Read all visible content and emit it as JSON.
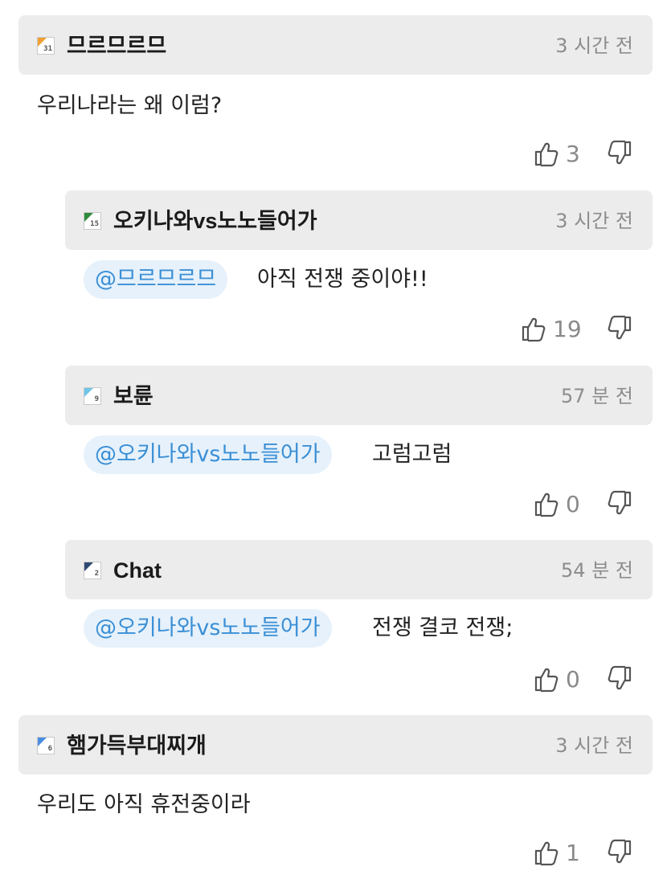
{
  "comments": [
    {
      "level": "31",
      "level_color": "#f0a033",
      "username": "므르므르므",
      "time": "3 시간 전",
      "text": "우리나라는 왜 이럼?",
      "likes": "3"
    },
    {
      "level": "15",
      "level_color": "#2f8a3c",
      "username": "오키나와vs노노들어가",
      "time": "3 시간 전",
      "mention": "@므르므르므",
      "text": "아직 전쟁 중이야!!",
      "likes": "19"
    },
    {
      "level": "9",
      "level_color": "#6ec6e8",
      "username": "보륜",
      "time": "57 분 전",
      "mention": "@오키나와vs노노들어가",
      "text": "고럼고럼",
      "likes": "0"
    },
    {
      "level": "2",
      "level_color": "#2e4a73",
      "username": "Chat",
      "time": "54 분 전",
      "mention": "@오키나와vs노노들어가",
      "text": "전쟁 결코 전쟁;",
      "likes": "0"
    },
    {
      "level": "6",
      "level_color": "#4a8ee0",
      "username": "햄가득부대찌개",
      "time": "3 시간 전",
      "text": "우리도 아직 휴전중이라",
      "likes": "1"
    }
  ],
  "icons": {
    "like": "thumbs-up-icon",
    "dislike": "thumbs-down-icon",
    "level": "level-badge-icon"
  }
}
